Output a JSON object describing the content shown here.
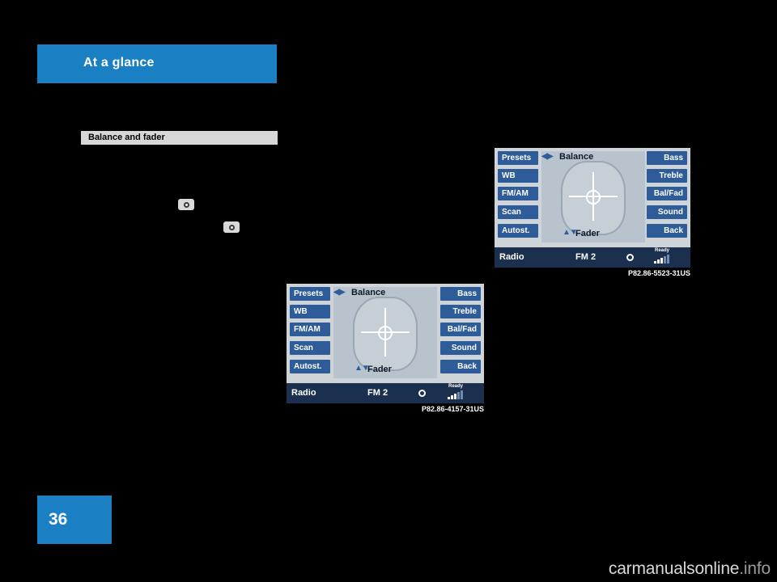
{
  "page": {
    "chapter_title": "At a glance",
    "page_number": "36",
    "section_heading": "Balance and fader",
    "watermark": "carmanualsonline",
    "watermark_suffix": ".info",
    "accent_color": "#1b7fc4",
    "heading_bg": "#d7d7d7"
  },
  "icons": {
    "controller_icon_1": "controller-icon",
    "controller_icon_2": "controller-icon"
  },
  "figures": [
    {
      "id": "figure-balance-fader-1",
      "caption": "P82.86-4157-31US",
      "left_buttons": [
        "Presets",
        "WB",
        "FM/AM",
        "Scan",
        "Autost."
      ],
      "right_buttons": [
        "Bass",
        "Treble",
        "Bal/Fad",
        "Sound",
        "Back"
      ],
      "balance_label": "Balance",
      "fader_label": "Fader",
      "balance_arrows": "◀▶",
      "fader_arrows": "▲▼",
      "status": {
        "source": "Radio",
        "band": "FM 2",
        "ready": "Ready",
        "signal_bars": 5,
        "signal_filled": 3
      }
    },
    {
      "id": "figure-balance-fader-2",
      "caption": "P82.86-5523-31US",
      "left_buttons": [
        "Presets",
        "WB",
        "FM/AM",
        "Scan",
        "Autost."
      ],
      "right_buttons": [
        "Bass",
        "Treble",
        "Bal/Fad",
        "Sound",
        "Back"
      ],
      "balance_label": "Balance",
      "fader_label": "Fader",
      "balance_arrows": "◀▶",
      "fader_arrows": "▲▼",
      "status": {
        "source": "Radio",
        "band": "FM 2",
        "ready": "Ready",
        "signal_bars": 5,
        "signal_filled": 3
      }
    }
  ]
}
